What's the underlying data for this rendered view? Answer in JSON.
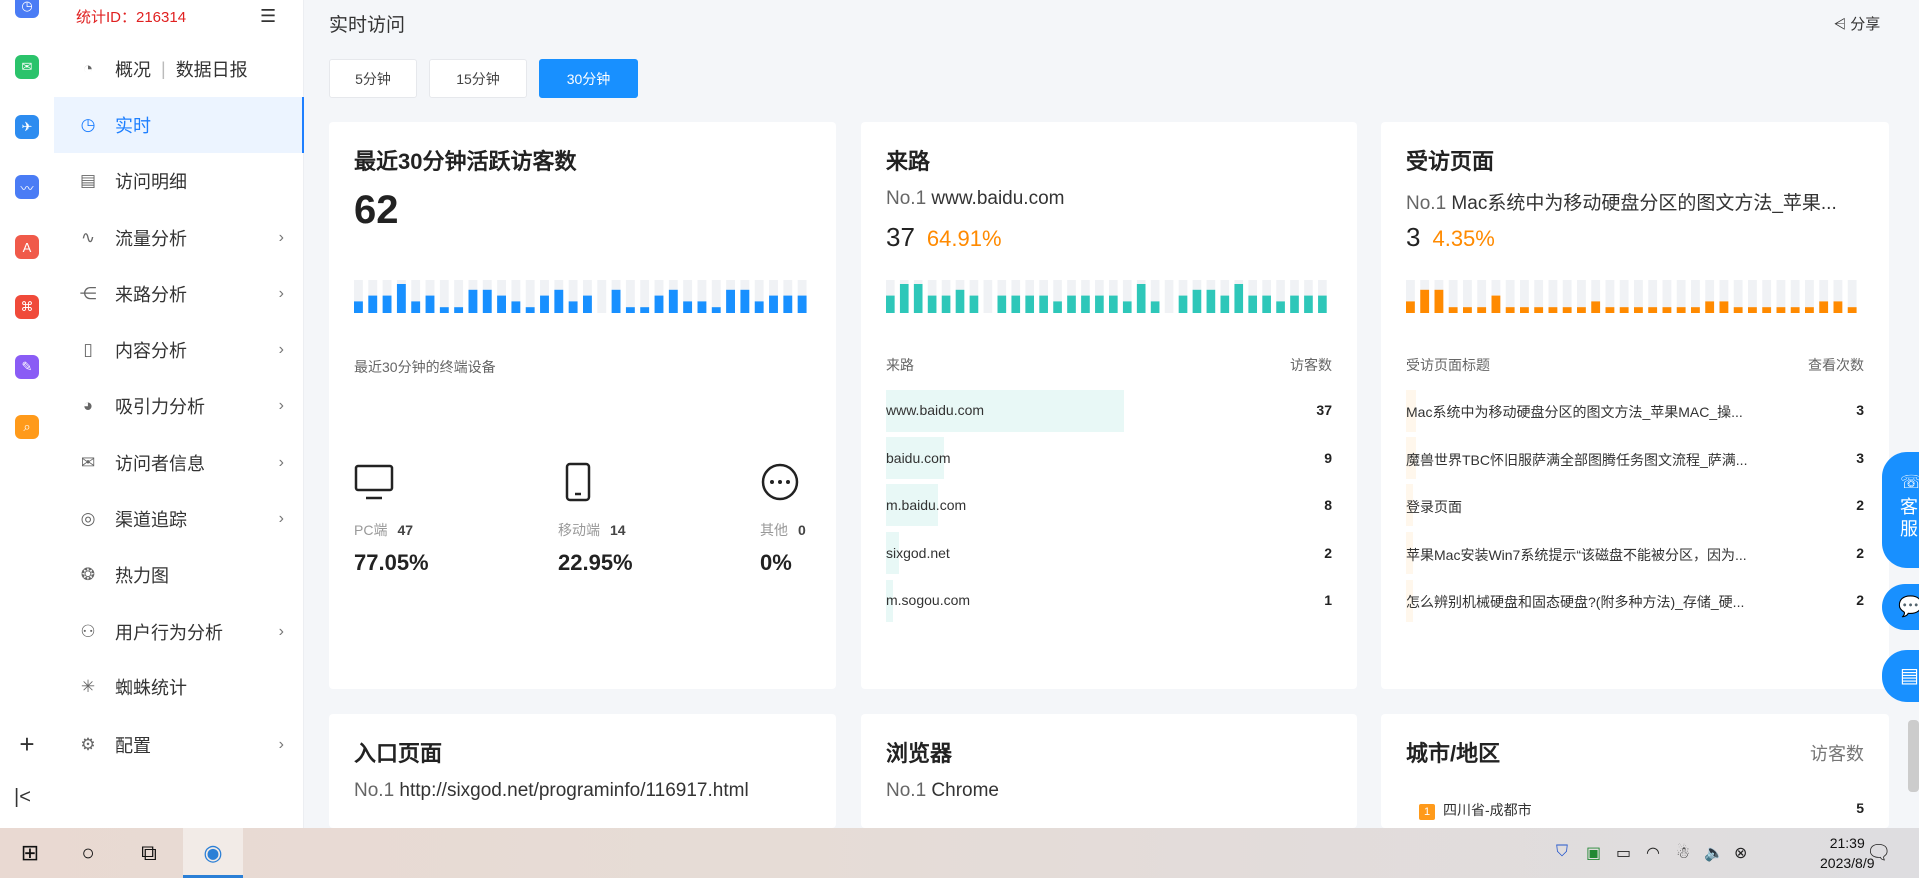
{
  "sidebar": {
    "stat_id": "统计ID：216314",
    "items": [
      {
        "label": "概况",
        "extra": "数据日报",
        "icon": "dashboard-icon"
      },
      {
        "label": "实时",
        "icon": "clock-icon"
      },
      {
        "label": "访问明细",
        "icon": "document-search-icon"
      },
      {
        "label": "流量分析",
        "icon": "pulse-icon"
      },
      {
        "label": "来路分析",
        "icon": "source-icon"
      },
      {
        "label": "内容分析",
        "icon": "file-icon"
      },
      {
        "label": "吸引力分析",
        "icon": "pie-icon"
      },
      {
        "label": "访问者信息",
        "icon": "mail-icon"
      },
      {
        "label": "渠道追踪",
        "icon": "target-icon"
      },
      {
        "label": "热力图",
        "icon": "heatmap-icon"
      },
      {
        "label": "用户行为分析",
        "icon": "users-icon"
      },
      {
        "label": "蜘蛛统计",
        "icon": "spider-icon"
      },
      {
        "label": "配置",
        "icon": "gear-icon"
      }
    ]
  },
  "header": {
    "title": "实时访问",
    "share": "分享"
  },
  "tabs": [
    "5分钟",
    "15分钟",
    "30分钟"
  ],
  "visitors_card": {
    "title": "最近30分钟活跃访客数",
    "count": "62",
    "devices_title": "最近30分钟的终端设备",
    "devices": [
      {
        "label": "PC端",
        "count": "47",
        "pct": "77.05%"
      },
      {
        "label": "移动端",
        "count": "14",
        "pct": "22.95%"
      },
      {
        "label": "其他",
        "count": "0",
        "pct": "0%"
      }
    ]
  },
  "source_card": {
    "title": "来路",
    "no1_label": "No.1",
    "no1_value": "www.baidu.com",
    "count": "37",
    "pct": "64.91%",
    "col_left": "来路",
    "col_right": "访客数",
    "rows": [
      {
        "label": "www.baidu.com",
        "value": "37"
      },
      {
        "label": "baidu.com",
        "value": "9"
      },
      {
        "label": "m.baidu.com",
        "value": "8"
      },
      {
        "label": "sixgod.net",
        "value": "2"
      },
      {
        "label": "m.sogou.com",
        "value": "1"
      }
    ]
  },
  "pages_card": {
    "title": "受访页面",
    "no1_label": "No.1",
    "no1_value": "Mac系统中为移动硬盘分区的图文方法_苹果...",
    "count": "3",
    "pct": "4.35%",
    "col_left": "受访页面标题",
    "col_right": "查看次数",
    "rows": [
      {
        "label": "Mac系统中为移动硬盘分区的图文方法_苹果MAC_操...",
        "value": "3"
      },
      {
        "label": "魔兽世界TBC怀旧服萨满全部图腾任务图文流程_萨满...",
        "value": "3"
      },
      {
        "label": "登录页面",
        "value": "2"
      },
      {
        "label": "苹果Mac安装Win7系统提示“该磁盘不能被分区，因为...",
        "value": "2"
      },
      {
        "label": "怎么辨别机械硬盘和固态硬盘?(附多种方法)_存储_硬...",
        "value": "2"
      }
    ]
  },
  "entry_card": {
    "title": "入口页面",
    "no1_label": "No.1",
    "no1_value": "http://sixgod.net/programinfo/116917.html"
  },
  "browser_card": {
    "title": "浏览器",
    "no1_label": "No.1",
    "no1_value": "Chrome"
  },
  "city_card": {
    "title": "城市/地区",
    "col_right": "访客数",
    "rows": [
      {
        "rank": "1",
        "label": "四川省-成都市",
        "value": "5"
      }
    ]
  },
  "float_buttons": [
    "客服",
    "chat-icon",
    "feedback-icon"
  ],
  "taskbar": {
    "time": "21:39",
    "date": "2023/8/9"
  },
  "colors": {
    "accent": "#1890ff",
    "teal": "#2ec7b9",
    "orange": "#ff8a00",
    "stat_red": "#e02020"
  },
  "sparklines": {
    "visitors": [
      2,
      3,
      3,
      5,
      2,
      3,
      1,
      1,
      4,
      4,
      3,
      2,
      1,
      3,
      4,
      2,
      3,
      0,
      4,
      1,
      1,
      3,
      4,
      2,
      2,
      1,
      4,
      4,
      2,
      3,
      3,
      3
    ],
    "source": [
      3,
      5,
      5,
      3,
      3,
      4,
      3,
      0,
      3,
      3,
      3,
      3,
      2,
      3,
      3,
      3,
      3,
      2,
      5,
      2,
      0,
      3,
      4,
      4,
      3,
      5,
      3,
      3,
      2,
      3,
      3,
      3
    ],
    "pages": [
      2,
      4,
      4,
      1,
      1,
      1,
      3,
      1,
      1,
      1,
      1,
      1,
      1,
      2,
      1,
      1,
      1,
      1,
      1,
      1,
      1,
      2,
      2,
      1,
      1,
      1,
      1,
      1,
      1,
      2,
      2,
      1
    ]
  }
}
